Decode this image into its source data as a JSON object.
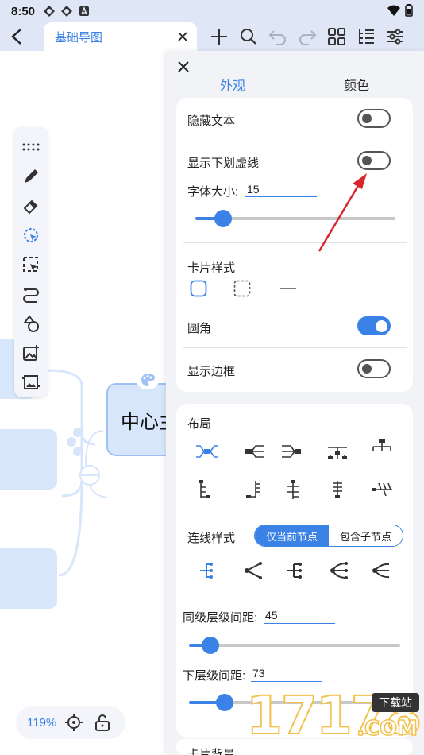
{
  "status_bar": {
    "time": "8:50"
  },
  "header": {
    "tab_title": "基础导图"
  },
  "canvas": {
    "center_node_text": "中心主",
    "zoom": "119%"
  },
  "panel": {
    "tabs": [
      "外观",
      "颜色"
    ],
    "active_tab": "外观",
    "card1": {
      "hide_text": {
        "label": "隐藏文本",
        "on": false
      },
      "show_underline": {
        "label": "显示下划虚线",
        "on": false
      },
      "font_size": {
        "label": "字体大小:",
        "value": "15",
        "slider_fraction": 0.14
      },
      "card_style_label": "卡片样式",
      "rounded": {
        "label": "圆角",
        "on": true
      },
      "show_border": {
        "label": "显示边框",
        "on": false
      }
    },
    "card2": {
      "layout_label": "布局",
      "line_style_label": "连线样式",
      "segment": [
        "仅当前节点",
        "包含子节点"
      ],
      "sibling_spacing": {
        "label": "同级层级间距:",
        "value": "45",
        "slider_fraction": 0.1
      },
      "child_spacing": {
        "label": "下层级间距:",
        "value": "73",
        "slider_fraction": 0.17
      }
    },
    "card3": {
      "label": "卡片背景"
    }
  },
  "watermark": {
    "text": "17178",
    "badge": "下载站",
    "suffix": ".COM"
  },
  "colors": {
    "accent": "#3b82e6",
    "node_fill": "#d7e6fb",
    "panel_bg": "#f1f3f7",
    "arrow": "#d8262c"
  }
}
